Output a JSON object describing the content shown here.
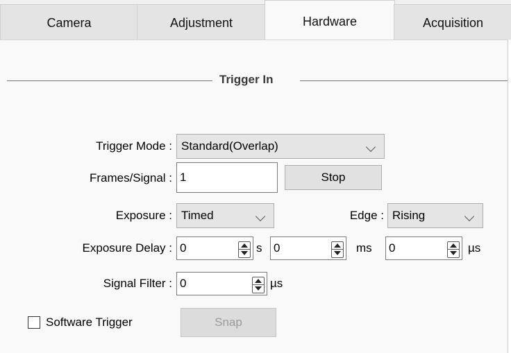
{
  "tabs": [
    {
      "label": "Camera"
    },
    {
      "label": "Adjustment"
    },
    {
      "label": "Hardware"
    },
    {
      "label": "Acquisition"
    }
  ],
  "active_tab": "Hardware",
  "group": {
    "title": "Trigger In"
  },
  "trigger_mode": {
    "label": "Trigger Mode :",
    "value": "Standard(Overlap)"
  },
  "frames_signal": {
    "label": "Frames/Signal :",
    "value": "1",
    "button": "Stop"
  },
  "exposure": {
    "label": "Exposure :",
    "value": "Timed"
  },
  "edge": {
    "label": "Edge :",
    "value": "Rising"
  },
  "exposure_delay": {
    "label": "Exposure Delay :",
    "s_value": "0",
    "s_unit": "s",
    "ms_value": "0",
    "ms_unit": "ms",
    "us_value": "0",
    "us_unit": "µs"
  },
  "signal_filter": {
    "label": "Signal Filter :",
    "value": "0",
    "unit": "µs"
  },
  "software_trigger": {
    "label": "Software Trigger",
    "checked": false,
    "button": "Snap"
  },
  "icons": {
    "dropdown": "chevron-down-icon",
    "spinner": "spinner-arrows-icon",
    "checkbox": "checkbox-icon"
  }
}
